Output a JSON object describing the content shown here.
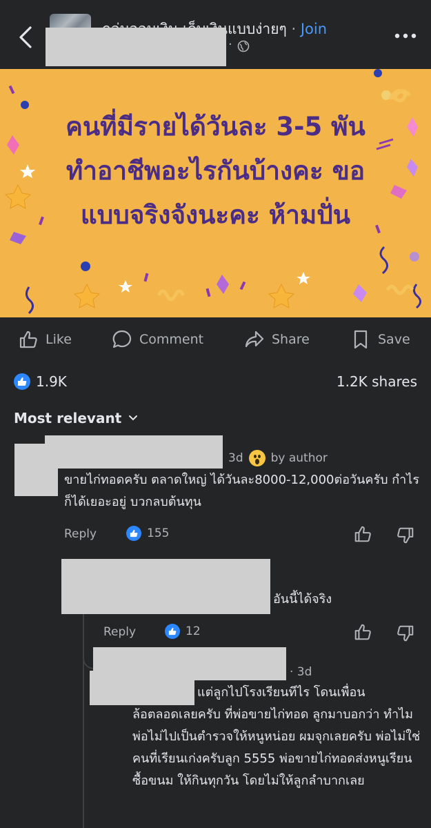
{
  "header": {
    "group_name": "กลุ่มออมเงิน เก็บเงินแบบง่ายๆ",
    "separator": "·",
    "join_label": "Join",
    "sub_dot": "·"
  },
  "banner": {
    "lines": [
      "คนที่มีรายได้วันละ 3-5 พัน",
      "ทำอาชีพอะไรกันบ้างคะ ขอ",
      "แบบจริงจังนะคะ ห้ามปั่น"
    ],
    "background": "#f3b44a",
    "text_color": "#4b2d86"
  },
  "actions": {
    "like": "Like",
    "comment": "Comment",
    "share": "Share",
    "save": "Save"
  },
  "stats": {
    "likes": "1.9K",
    "shares": "1.2K shares"
  },
  "sort_label": "Most relevant",
  "comments": [
    {
      "time": "3d",
      "badge": "by author",
      "text": "ขายไก่ทอดครับ ตลาดใหญ่ ได้วันละ8000-12,000ต่อวันครับ กำไรก็ได้เยอะอยู่ บวกลบต้นทุน",
      "reply_label": "Reply",
      "reactions": "155"
    },
    {
      "text": "อันนี้ได้จริง",
      "reply_label": "Reply",
      "reactions": "12"
    },
    {
      "time": "· 3d",
      "text_first": "แต่ลูกไปโรงเรียนทีไร โดนเพื่อน",
      "text_rest": "ล้อตลอดเลยครับ ที่พ่อขายไก่ทอด ลูกมาบอกว่า ทำไมพ่อไม่ไปเป็นตำรวจให้หนูหน่อย ผมจุกเลยครับ พ่อไม่ใช่คนที่เรียนเก่งครับลูก 5555 พ่อขายไก่ทอดส่งหนูเรียน ซื้อขนม ให้กินทุกวัน โดยไม่ให้ลูกลำบากเลย"
    }
  ],
  "colors": {
    "background": "#242526",
    "accent": "#2d88ff",
    "link": "#4599ff"
  }
}
